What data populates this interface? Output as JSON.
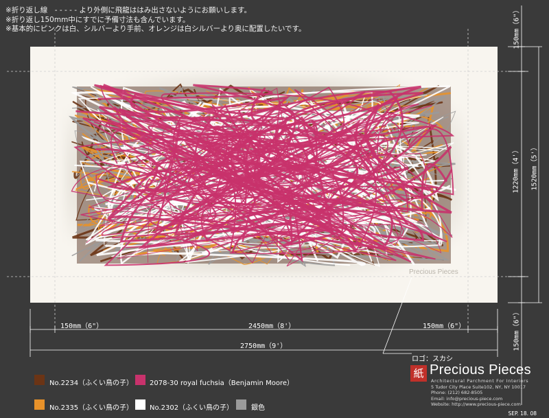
{
  "notes": [
    "※折り返し線　- - - - - より外側に飛龍ははみ出さないようにお願いします。",
    "※折り返し150mm中にすでに予備寸法も含んでいます。",
    "※基本的にピンクは白、シルバーより手前、オレンジは白シルバーより奥に配置したいです。"
  ],
  "dimensions": {
    "left_fold": "150mm（6\"）",
    "center_width": "2450mm（8'）",
    "right_fold": "150mm（6\"）",
    "total_width": "2750mm（9'）",
    "top_fold": "150mm（6\"）",
    "center_height": "1220mm（4'）",
    "total_height": "1520mm（5'）",
    "bottom_fold": "150mm（6\"）"
  },
  "watermark": "Precious Pieces",
  "logo_note": "ロゴ：スカシ",
  "legend": [
    {
      "color": "#6b3415",
      "label": "No.2234（ふくい鳥の子）"
    },
    {
      "color": "#c8326c",
      "label": "2078-30 royal fuchsia（Benjamin Moore）"
    },
    {
      "color": "#e8922a",
      "label": "No.2335（ふくい鳥の子）"
    },
    {
      "color": "#ffffff",
      "label": "No.2302（ふくい鳥の子）"
    },
    {
      "color": "#9a9a9a",
      "label": "銀色"
    }
  ],
  "brand": {
    "mark": "紙",
    "name": "Precious Pieces",
    "tagline": "Architectural Parchment For Interiors",
    "address": "5 Tudor City Place Suite102, NY, NY 10017",
    "phone": "Phone: (212) 682-8505",
    "email": "Email: info@precious-piece.com",
    "website": "Website: http://www.precious-piece.com"
  },
  "date": "SEP. 18. 08"
}
